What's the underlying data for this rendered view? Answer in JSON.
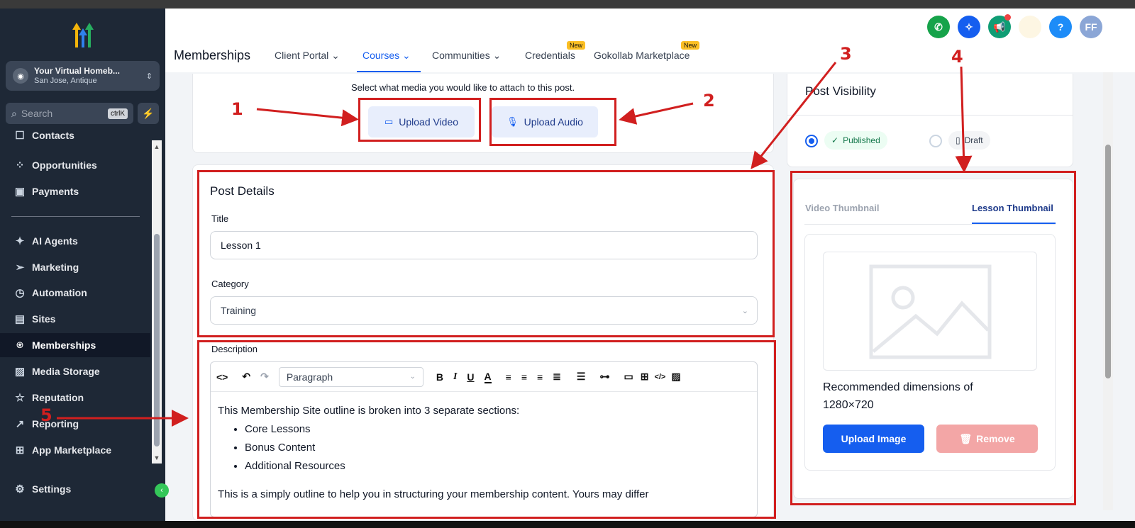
{
  "sidebar": {
    "account": {
      "name": "Your Virtual Homeb...",
      "location": "San Jose, Antique"
    },
    "search": {
      "placeholder": "Search",
      "shortcut": "ctrlK"
    },
    "items": [
      {
        "label": "Contacts",
        "icon": "contacts-icon"
      },
      {
        "label": "Opportunities",
        "icon": "opportunities-icon"
      },
      {
        "label": "Payments",
        "icon": "payments-icon"
      },
      {
        "label": "AI Agents",
        "icon": "sparkle-icon"
      },
      {
        "label": "Marketing",
        "icon": "send-icon"
      },
      {
        "label": "Automation",
        "icon": "automation-icon"
      },
      {
        "label": "Sites",
        "icon": "sites-icon"
      },
      {
        "label": "Memberships",
        "icon": "badge-icon",
        "active": true
      },
      {
        "label": "Media Storage",
        "icon": "image-icon"
      },
      {
        "label": "Reputation",
        "icon": "star-icon"
      },
      {
        "label": "Reporting",
        "icon": "chart-icon"
      },
      {
        "label": "App Marketplace",
        "icon": "grid-icon"
      },
      {
        "label": "Settings",
        "icon": "gear-icon"
      }
    ]
  },
  "header": {
    "title": "Memberships",
    "tabs": [
      {
        "label": "Client Portal",
        "dropdown": true
      },
      {
        "label": "Courses",
        "dropdown": true,
        "active": true
      },
      {
        "label": "Communities",
        "dropdown": true
      },
      {
        "label": "Credentials",
        "badge": "New"
      },
      {
        "label": "Gokollab Marketplace",
        "badge": "New"
      }
    ],
    "avatar": "FF",
    "help": "?",
    "colors": {
      "phone": "#16a34a",
      "ai": "#155eef",
      "announce": "#0f9d74",
      "help": "#1d8cf8",
      "avatar": "#8ba6d6"
    }
  },
  "media": {
    "prompt": "Select what media you would like to attach to this post.",
    "upload_video": "Upload Video",
    "upload_audio": "Upload Audio"
  },
  "post_details": {
    "heading": "Post Details",
    "title_label": "Title",
    "title_value": "Lesson 1",
    "category_label": "Category",
    "category_value": "Training"
  },
  "description": {
    "label": "Description",
    "format": "Paragraph",
    "intro": "This Membership Site outline is broken into 3 separate sections:",
    "bullets": [
      "Core Lessons",
      "Bonus Content",
      "Additional Resources"
    ],
    "outro": "This is a simply outline to help you in structuring your membership content. Yours may differ"
  },
  "visibility": {
    "heading": "Post Visibility",
    "published": "Published",
    "draft": "Draft",
    "selected": "Published"
  },
  "thumbnail": {
    "tab_video": "Video Thumbnail",
    "tab_lesson": "Lesson Thumbnail",
    "active_tab": "Lesson Thumbnail",
    "recommended": "Recommended dimensions of 1280×720",
    "upload": "Upload Image",
    "remove": "Remove"
  },
  "annotations": [
    "1",
    "2",
    "3",
    "4",
    "5"
  ],
  "accent": "#155eef",
  "annotation_color": "#d11f1f"
}
